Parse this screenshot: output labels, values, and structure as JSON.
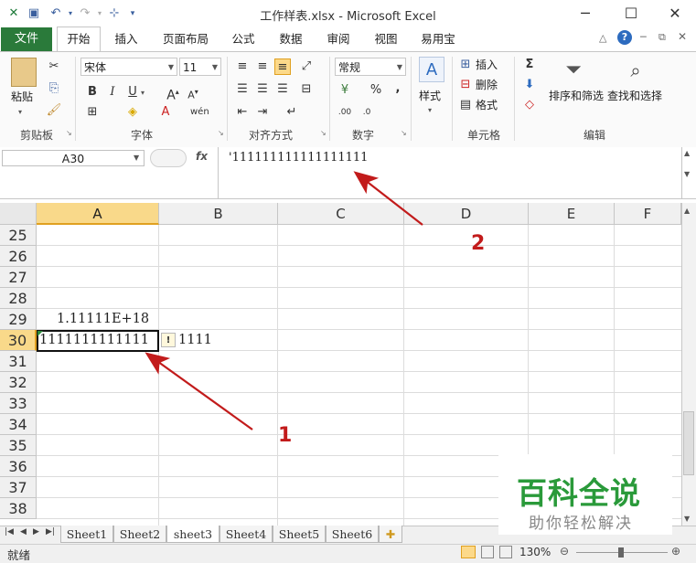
{
  "window": {
    "title": "工作样表.xlsx - Microsoft Excel",
    "controls": {
      "minimize": "─",
      "maximize": "☐",
      "close": "✕"
    }
  },
  "tabs": {
    "file": "文件",
    "items": [
      "开始",
      "插入",
      "页面布局",
      "公式",
      "数据",
      "审阅",
      "视图",
      "易用宝"
    ],
    "active": "开始"
  },
  "ribbon": {
    "clipboard": {
      "label": "剪贴板",
      "paste": "粘贴"
    },
    "font": {
      "label": "字体",
      "name": "宋体",
      "size": "11",
      "bold": "B",
      "italic": "I",
      "underline": "U"
    },
    "alignment": {
      "label": "对齐方式"
    },
    "number": {
      "label": "数字",
      "format": "常规",
      "percent": "%",
      "comma": ","
    },
    "styles": {
      "label": "样式"
    },
    "cells": {
      "label": "单元格",
      "insert": "插入",
      "delete": "删除",
      "format": "格式"
    },
    "editing": {
      "label": "编辑",
      "sort": "排序和筛选",
      "find": "查找和选择"
    }
  },
  "formula_bar": {
    "name_box": "A30",
    "fx": "fx",
    "content": "'111111111111111111"
  },
  "sheet": {
    "columns": [
      "A",
      "B",
      "C",
      "D",
      "E",
      "F"
    ],
    "selected_column": "A",
    "rows": [
      "25",
      "26",
      "27",
      "28",
      "29",
      "30",
      "31",
      "32",
      "33",
      "34",
      "35",
      "36",
      "37",
      "38"
    ],
    "selected_row": "30",
    "cells": {
      "A29": "1.11111E+18",
      "A30": "1111111111111",
      "B30_overflow": "1111"
    },
    "error_indicator": "!"
  },
  "sheet_tabs": {
    "items": [
      "Sheet1",
      "Sheet2",
      "sheet3",
      "Sheet4",
      "Sheet5",
      "Sheet6"
    ],
    "active": "sheet3"
  },
  "status": {
    "ready": "就绪",
    "zoom": "130%"
  },
  "annotations": {
    "label_1": "1",
    "label_2": "2",
    "color": "#c21b1b"
  },
  "watermark": {
    "title": "百科全说",
    "subtitle": "助你轻松解决"
  }
}
